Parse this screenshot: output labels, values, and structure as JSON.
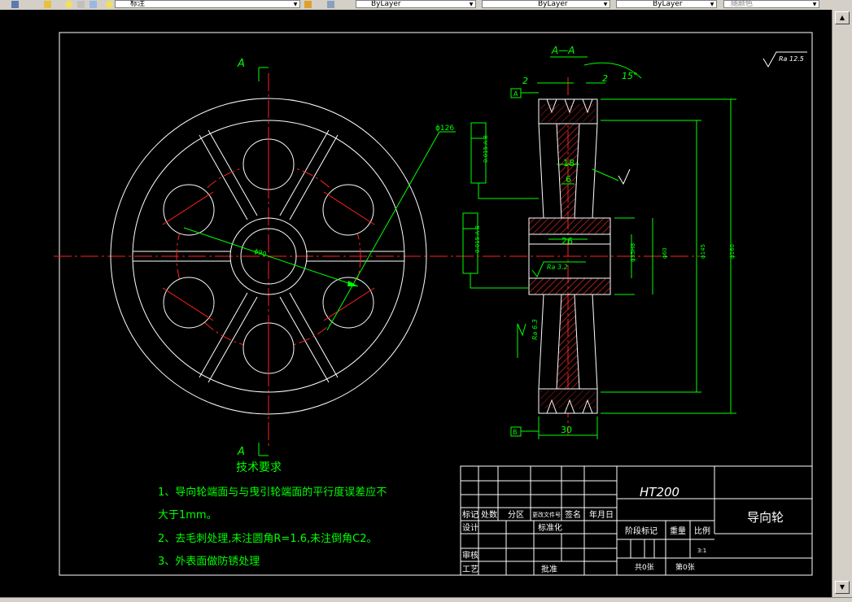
{
  "toolbar": {
    "style_combo": "标注",
    "layer_combo": "ByLayer",
    "linetype_combo": "ByLayer",
    "lineweight_combo": "ByLayer",
    "plotstyle_combo": "随颜色"
  },
  "drawing": {
    "section_label": "A",
    "section_view_title": "A—A",
    "roughness_general": "Ra 12.5",
    "roughness_bore": "Ra 3.2",
    "roughness_side": "Ra 6.3",
    "datum_a": "A",
    "datum_b": "B",
    "tolerance_top": "0.015  A-B",
    "tolerance_mid": "0.015  A-B",
    "dim_pcd": "ϕ126",
    "dim_hub_bore": "ϕ90",
    "dim_top_2": "2",
    "dim_top_2b": "2",
    "dim_angle": "15°",
    "dim_18": "18",
    "dim_6": "6",
    "dim_26": "26",
    "dim_30": "30",
    "dim_d1": "ϕ35H8",
    "dim_d2": "ϕ60",
    "dim_d3": "ϕ145",
    "dim_d4": "ϕ160"
  },
  "tech": {
    "title": "技术要求",
    "line1": "1、导向轮端面与与曳引轮端面的平行度误差应不",
    "line1b": "大于1mm。",
    "line2": "2、去毛刺处理,未注圆角R=1.6,未注倒角C2。",
    "line3": "3、外表面做防锈处理"
  },
  "titleblock": {
    "material": "HT200",
    "part_name": "导向轮",
    "h_mark": "标记",
    "h_count": "处数",
    "h_zone": "分区",
    "h_docno": "更改文件号",
    "h_sign": "签名",
    "h_date": "年月日",
    "design": "设计",
    "standard": "标准化",
    "stage": "阶段标记",
    "weight": "重量",
    "scale": "比例",
    "scale_val": "3:1",
    "check": "审核",
    "process": "工艺",
    "approve": "批准",
    "total": "共0张",
    "sheet": "第0张"
  }
}
